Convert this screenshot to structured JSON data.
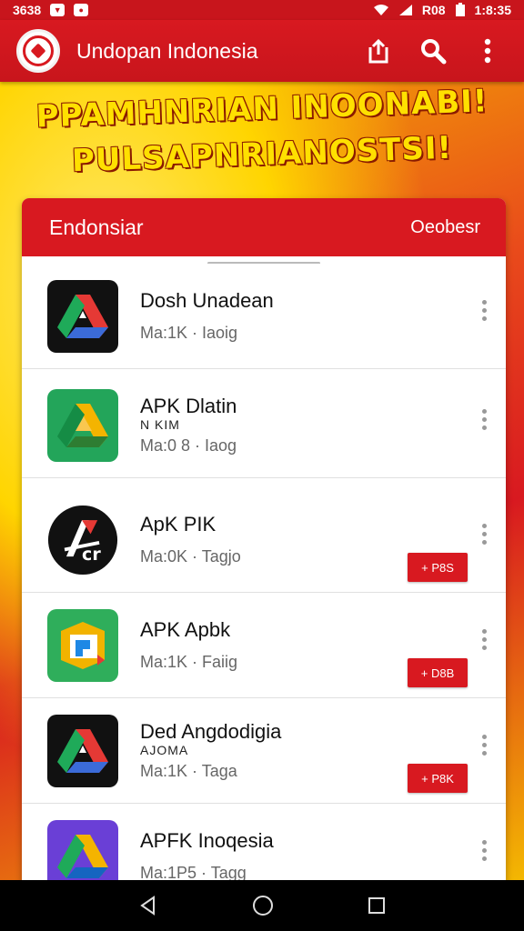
{
  "status_bar": {
    "time_left": "3638",
    "battery_text": "R08",
    "time_right": "1:8:35"
  },
  "app_bar": {
    "title": "Undopan Indonesia",
    "icons": [
      "logo-seal-icon",
      "share-icon",
      "search-icon",
      "more-vert-icon"
    ]
  },
  "banner": {
    "line1": "PPAMHNRIAN INOONABI!",
    "line2": "PULSAPNRIANOSTSI!"
  },
  "card": {
    "header_left": "Endonsiar",
    "header_right": "Oeobesr"
  },
  "apps": [
    {
      "name": "Dosh Unadean",
      "sub": "",
      "meta": "Ma:1K · Iaoig",
      "button": "",
      "icon": "drive-dark-icon"
    },
    {
      "name": "APK Dlatin",
      "sub": "N KIM",
      "meta": "Ma:0 8 · Iaog",
      "button": "",
      "icon": "drive-green-icon"
    },
    {
      "name": "ApK PIK",
      "sub": "",
      "meta": "Ma:0K · Tagjo",
      "button": "+ P8S",
      "icon": "apk-black-circle-icon"
    },
    {
      "name": "APK Apbk",
      "sub": "",
      "meta": "Ma:1K · Faiig",
      "button": "+ D8B",
      "icon": "apk-green-square-icon"
    },
    {
      "name": "Ded Angdodigia",
      "sub": "AJOMA",
      "meta": "Ma:1K · Taga",
      "button": "+ P8K",
      "icon": "drive-dark-icon"
    },
    {
      "name": "APFK Inoqesia",
      "sub": "",
      "meta": "Ma:1P5 · Tagg",
      "button": "",
      "icon": "drive-purple-icon"
    }
  ],
  "nav_bar": {
    "icons": [
      "back-icon",
      "home-icon",
      "recents-icon"
    ]
  },
  "colors": {
    "brand_red": "#d81920",
    "banner_yellow": "#ffe000"
  }
}
